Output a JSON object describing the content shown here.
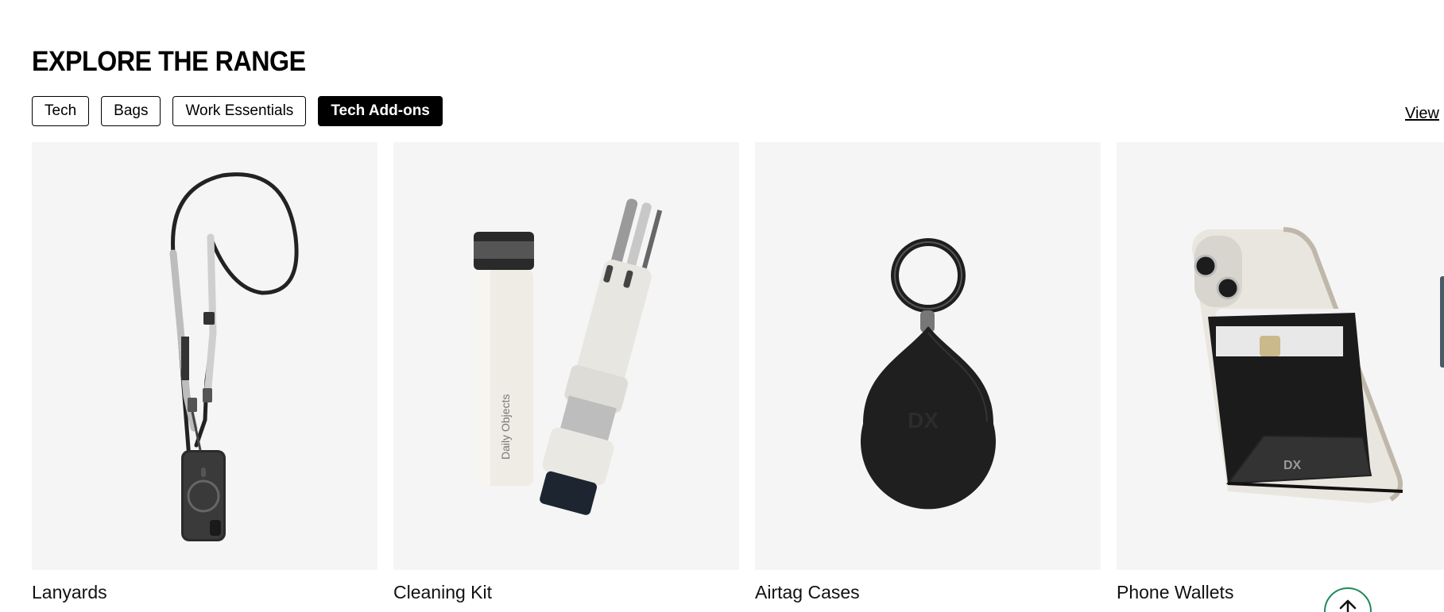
{
  "section": {
    "title": "EXPLORE THE RANGE",
    "view_link": "View"
  },
  "tabs": [
    {
      "label": "Tech",
      "active": false
    },
    {
      "label": "Bags",
      "active": false
    },
    {
      "label": "Work Essentials",
      "active": false
    },
    {
      "label": "Tech Add-ons",
      "active": true
    }
  ],
  "products": [
    {
      "name": "Lanyards",
      "image": "lanyard-phone-image"
    },
    {
      "name": "Cleaning Kit",
      "image": "cleaning-kit-image"
    },
    {
      "name": "Airtag Cases",
      "image": "airtag-case-image"
    },
    {
      "name": "Phone Wallets",
      "image": "phone-wallet-image"
    }
  ],
  "product_text": {
    "cleaning_bottle_brand": "Daily Objects",
    "logo_mark": "DX"
  },
  "icons": {
    "back_to_top": "arrow-up-icon"
  },
  "colors": {
    "card_background": "#f5f5f5",
    "active_tab": "#000000",
    "back_to_top_border": "#1f8a5a"
  }
}
